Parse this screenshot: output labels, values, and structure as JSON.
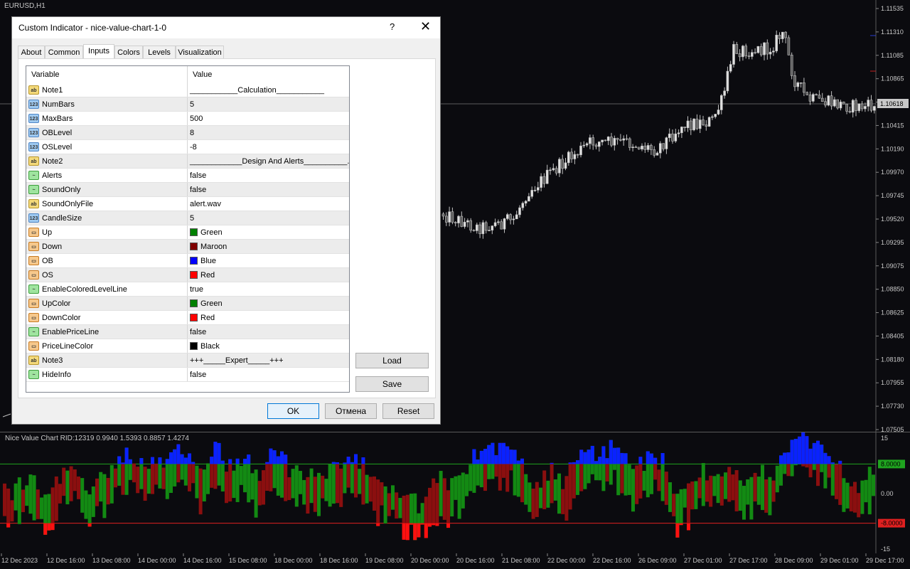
{
  "chart": {
    "symbol_label": "EURUSD,H1",
    "price_labels": [
      "1.11535",
      "1.11310",
      "1.11085",
      "1.10865",
      "1.10618",
      "1.10415",
      "1.10190",
      "1.09970",
      "1.09745",
      "1.09520",
      "1.09295",
      "1.09075",
      "1.08850",
      "1.08625",
      "1.08405",
      "1.08180",
      "1.07955",
      "1.07730",
      "1.07505"
    ],
    "current_price": "1.10618",
    "indicator_title": "Nice Value Chart RID:12319 0.9940 1.5393 0.8857 1.4274",
    "indicator_scale": [
      "15",
      "8.0000",
      "0.00",
      "-8.0000",
      "-15"
    ],
    "time_labels": [
      "12 Dec 2023",
      "12 Dec 16:00",
      "13 Dec 08:00",
      "14 Dec 00:00",
      "14 Dec 16:00",
      "15 Dec 08:00",
      "18 Dec 00:00",
      "18 Dec 16:00",
      "19 Dec 08:00",
      "20 Dec 00:00",
      "20 Dec 16:00",
      "21 Dec 08:00",
      "22 Dec 00:00",
      "22 Dec 16:00",
      "26 Dec 09:00",
      "27 Dec 01:00",
      "27 Dec 17:00",
      "28 Dec 09:00",
      "29 Dec 01:00",
      "29 Dec 17:00"
    ],
    "colors": {
      "background": "#0b0b0f",
      "candle": "#c0c0c0",
      "ob_level": "#1fa31f",
      "os_level": "#e02020",
      "up": "#138a13",
      "down": "#8b0f0f",
      "ob": "#0a22ff",
      "os": "#ff1010"
    }
  },
  "dialog": {
    "title": "Custom Indicator - nice-value-chart-1-0",
    "help": "?",
    "close": "✕",
    "tabs": [
      "About",
      "Common",
      "Inputs",
      "Colors",
      "Levels",
      "Visualization"
    ],
    "active_tab": "Inputs",
    "grid_headers": {
      "variable": "Variable",
      "value": "Value"
    },
    "params": [
      {
        "type": "ab",
        "name": "Note1",
        "value": "___________Calculation___________"
      },
      {
        "type": "123",
        "name": "NumBars",
        "value": "5"
      },
      {
        "type": "123",
        "name": "MaxBars",
        "value": "500"
      },
      {
        "type": "123",
        "name": "OBLevel",
        "value": "8"
      },
      {
        "type": "123",
        "name": "OSLevel",
        "value": "-8"
      },
      {
        "type": "ab",
        "name": "Note2",
        "value": "____________Design And Alerts__________..."
      },
      {
        "type": "bool",
        "name": "Alerts",
        "value": "false"
      },
      {
        "type": "bool",
        "name": "SoundOnly",
        "value": "false"
      },
      {
        "type": "ab",
        "name": "SoundOnlyFile",
        "value": "alert.wav"
      },
      {
        "type": "123",
        "name": "CandleSize",
        "value": "5"
      },
      {
        "type": "color",
        "name": "Up",
        "value": "Green",
        "color": "#008000"
      },
      {
        "type": "color",
        "name": "Down",
        "value": "Maroon",
        "color": "#800000"
      },
      {
        "type": "color",
        "name": "OB",
        "value": "Blue",
        "color": "#0000ff"
      },
      {
        "type": "color",
        "name": "OS",
        "value": "Red",
        "color": "#ff0000"
      },
      {
        "type": "bool",
        "name": "EnableColoredLevelLine",
        "value": "true"
      },
      {
        "type": "color",
        "name": "UpColor",
        "value": "Green",
        "color": "#008000"
      },
      {
        "type": "color",
        "name": "DownColor",
        "value": "Red",
        "color": "#ff0000"
      },
      {
        "type": "bool",
        "name": "EnablePriceLine",
        "value": "false"
      },
      {
        "type": "color",
        "name": "PriceLineColor",
        "value": "Black",
        "color": "#000000"
      },
      {
        "type": "ab",
        "name": "Note3",
        "value": "+++_____Expert_____+++"
      },
      {
        "type": "bool",
        "name": "HideInfo",
        "value": "false"
      }
    ],
    "buttons": {
      "load": "Load",
      "save": "Save",
      "ok": "OK",
      "cancel": "Отмена",
      "reset": "Reset"
    }
  }
}
